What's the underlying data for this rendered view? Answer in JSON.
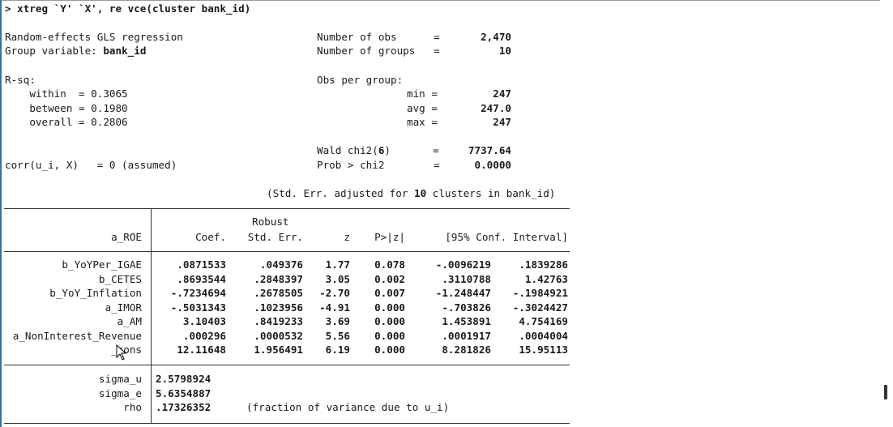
{
  "command": "> xtreg `Y' `X', re vce(cluster bank_id)",
  "header": {
    "model": "Random-effects GLS regression",
    "group_label": "Group variable: ",
    "group_var": "bank_id",
    "rsq_label": "R-sq:",
    "within": "    within  = 0.3065",
    "between": "    between = 0.1980",
    "overall": "    overall = 0.2806",
    "corr": "corr(u_i, X)   = 0 (assumed)",
    "nobs_label": "Number of obs      =",
    "nobs": "2,470",
    "ngroups_label": "Number of groups   =",
    "ngroups": "10",
    "obs_per_group": "Obs per group:",
    "min_label": "min =",
    "min": "247",
    "avg_label": "avg =",
    "avg": "247.0",
    "max_label": "max =",
    "max": "247",
    "wald_label": "Wald chi2(",
    "wald_df": "6",
    "wald_close": ")",
    "wald_eq": "=",
    "wald": "7737.64",
    "prob_label": "Prob > chi2        =",
    "prob": "0.0000",
    "stderr_note_a": "(Std. Err. adjusted for ",
    "stderr_note_n": "10",
    "stderr_note_b": " clusters in bank_id)"
  },
  "table": {
    "robust": "Robust",
    "depvar": "a_ROE",
    "col_coef": "Coef.",
    "col_se": "Std. Err.",
    "col_z": "z",
    "col_p": "P>|z|",
    "col_ci": "[95% Conf. Interval]",
    "rows": [
      {
        "var": "b_YoYPer_IGAE",
        "coef": ".0871533",
        "se": ".049376",
        "z": "1.77",
        "p": "0.078",
        "lo": "-.0096219",
        "hi": ".1839286"
      },
      {
        "var": "b_CETES",
        "coef": ".8693544",
        "se": ".2848397",
        "z": "3.05",
        "p": "0.002",
        "lo": ".3110788",
        "hi": "1.42763"
      },
      {
        "var": "b_YoY_Inflation",
        "coef": "-.7234694",
        "se": ".2678505",
        "z": "-2.70",
        "p": "0.007",
        "lo": "-1.248447",
        "hi": "-.1984921"
      },
      {
        "var": "a_IMOR",
        "coef": "-.5031343",
        "se": ".1023956",
        "z": "-4.91",
        "p": "0.000",
        "lo": "-.703826",
        "hi": "-.3024427"
      },
      {
        "var": "a_AM",
        "coef": "3.10403",
        "se": ".8419233",
        "z": "3.69",
        "p": "0.000",
        "lo": "1.453891",
        "hi": "4.754169"
      },
      {
        "var": "a_NonInterest_Revenue",
        "coef": ".000296",
        "se": ".0000532",
        "z": "5.56",
        "p": "0.000",
        "lo": ".0001917",
        "hi": ".0004004"
      },
      {
        "var": "_cons",
        "coef": "12.11648",
        "se": "1.956491",
        "z": "6.19",
        "p": "0.000",
        "lo": "8.281826",
        "hi": "15.95113"
      }
    ],
    "sigma_u_label": "sigma_u",
    "sigma_u": "2.5798924",
    "sigma_e_label": "sigma_e",
    "sigma_e": "5.6354887",
    "rho_label": "rho",
    "rho": ".17326352",
    "rho_note": "(fraction of variance due to u_i)"
  }
}
